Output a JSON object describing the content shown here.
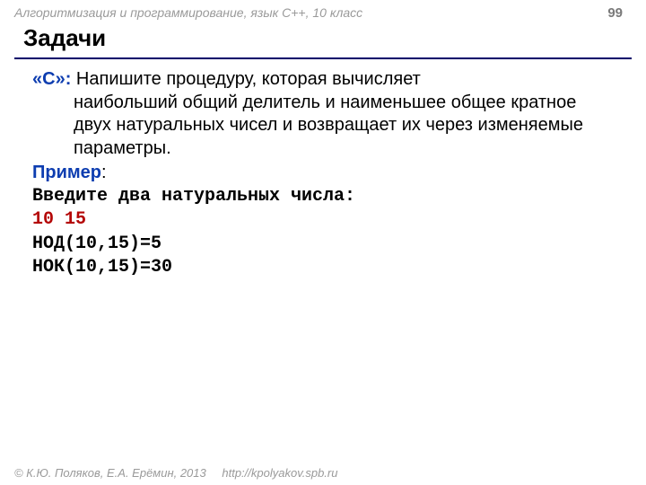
{
  "header": {
    "course": "Алгоритмизация и программирование, язык  C++, 10 класс",
    "page": "99"
  },
  "title": "Задачи",
  "task": {
    "tag": "«C»:",
    "text_first": " Напишите процедуру, которая вычисляет",
    "text_rest": "наибольший общий делитель и наименьшее общее кратное двух натуральных чисел и возвращает их через изменяемые параметры."
  },
  "example": {
    "label": "Пример",
    "colon": ":",
    "prompt": "Введите два натуральных числа:",
    "input": "10 15",
    "out1": "НОД(10,15)=5",
    "out2": "НОК(10,15)=30"
  },
  "footer": {
    "copyright": "© К.Ю. Поляков, Е.А. Ерёмин, 2013",
    "url": "http://kpolyakov.spb.ru"
  }
}
